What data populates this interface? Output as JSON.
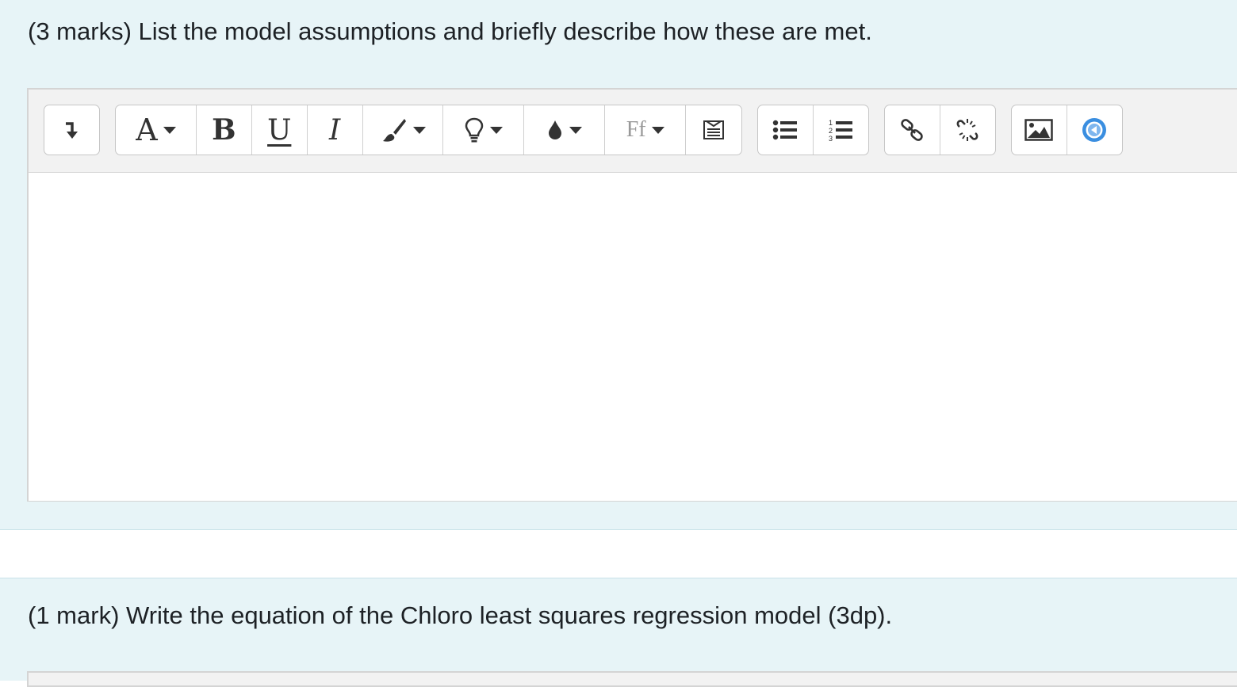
{
  "questions": [
    {
      "text": "(3 marks) List the model assumptions and briefly describe how these are met."
    },
    {
      "text": "(1 mark) Write the equation of the Chloro least squares regression model (3dp)."
    }
  ],
  "toolbar": {
    "groups": [
      {
        "name": "collapse",
        "buttons": [
          {
            "icon": "arrow-down-right-icon"
          }
        ]
      },
      {
        "name": "style",
        "buttons": [
          {
            "icon": "font-size-icon",
            "label": "A",
            "dropdown": true
          },
          {
            "icon": "bold-icon",
            "label": "B"
          },
          {
            "icon": "underline-icon",
            "label": "U"
          },
          {
            "icon": "italic-icon",
            "label": "I"
          },
          {
            "icon": "paintbrush-icon",
            "dropdown": true
          },
          {
            "icon": "lightbulb-icon",
            "dropdown": true
          },
          {
            "icon": "droplet-icon",
            "dropdown": true
          },
          {
            "icon": "font-family-icon",
            "label": "Ff",
            "dropdown": true
          },
          {
            "icon": "clear-format-icon"
          }
        ]
      },
      {
        "name": "lists",
        "buttons": [
          {
            "icon": "bullet-list-icon"
          },
          {
            "icon": "numbered-list-icon"
          }
        ]
      },
      {
        "name": "links",
        "buttons": [
          {
            "icon": "link-icon"
          },
          {
            "icon": "unlink-icon"
          }
        ]
      },
      {
        "name": "media",
        "buttons": [
          {
            "icon": "image-icon"
          },
          {
            "icon": "media-icon"
          }
        ]
      }
    ],
    "numbered_list_digits": [
      "1",
      "2",
      "3"
    ]
  },
  "colors": {
    "block_bg": "#e7f4f7",
    "media_accent": "#3a8ee0"
  }
}
